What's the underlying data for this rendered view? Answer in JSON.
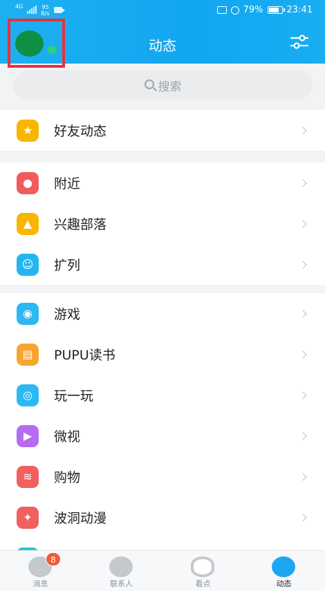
{
  "status_bar": {
    "network": "4G",
    "speed_value": "95",
    "speed_unit": "B/s",
    "battery": "79%",
    "time": "23:41"
  },
  "header": {
    "title": "动态"
  },
  "search": {
    "placeholder": "搜索"
  },
  "groups": [
    {
      "items": [
        {
          "label": "好友动态",
          "icon": "star-icon",
          "color": "#f8b600"
        }
      ]
    },
    {
      "items": [
        {
          "label": "附近",
          "icon": "location-pin-icon",
          "color": "#f25b5b"
        },
        {
          "label": "兴趣部落",
          "icon": "tent-icon",
          "color": "#f8b600"
        },
        {
          "label": "扩列",
          "icon": "chat-face-icon",
          "color": "#23b6f2"
        }
      ]
    },
    {
      "items": [
        {
          "label": "游戏",
          "icon": "gamepad-icon",
          "color": "#2cb9f3"
        },
        {
          "label": "PUPU读书",
          "icon": "book-icon",
          "color": "#f7a531"
        },
        {
          "label": "玩一玩",
          "icon": "planet-icon",
          "color": "#2cb9f3"
        },
        {
          "label": "微视",
          "icon": "play-icon",
          "color": "#b56cf0"
        },
        {
          "label": "购物",
          "icon": "shopping-icon",
          "color": "#f2605e"
        },
        {
          "label": "波洞动漫",
          "icon": "anime-icon",
          "color": "#f2605e"
        }
      ]
    }
  ],
  "tabbar": {
    "tabs": [
      {
        "label": "消息",
        "icon": "message-icon",
        "badge": "8"
      },
      {
        "label": "联系人",
        "icon": "contacts-icon"
      },
      {
        "label": "看点",
        "icon": "eye-icon"
      },
      {
        "label": "动态",
        "icon": "planet-star-icon"
      }
    ]
  }
}
